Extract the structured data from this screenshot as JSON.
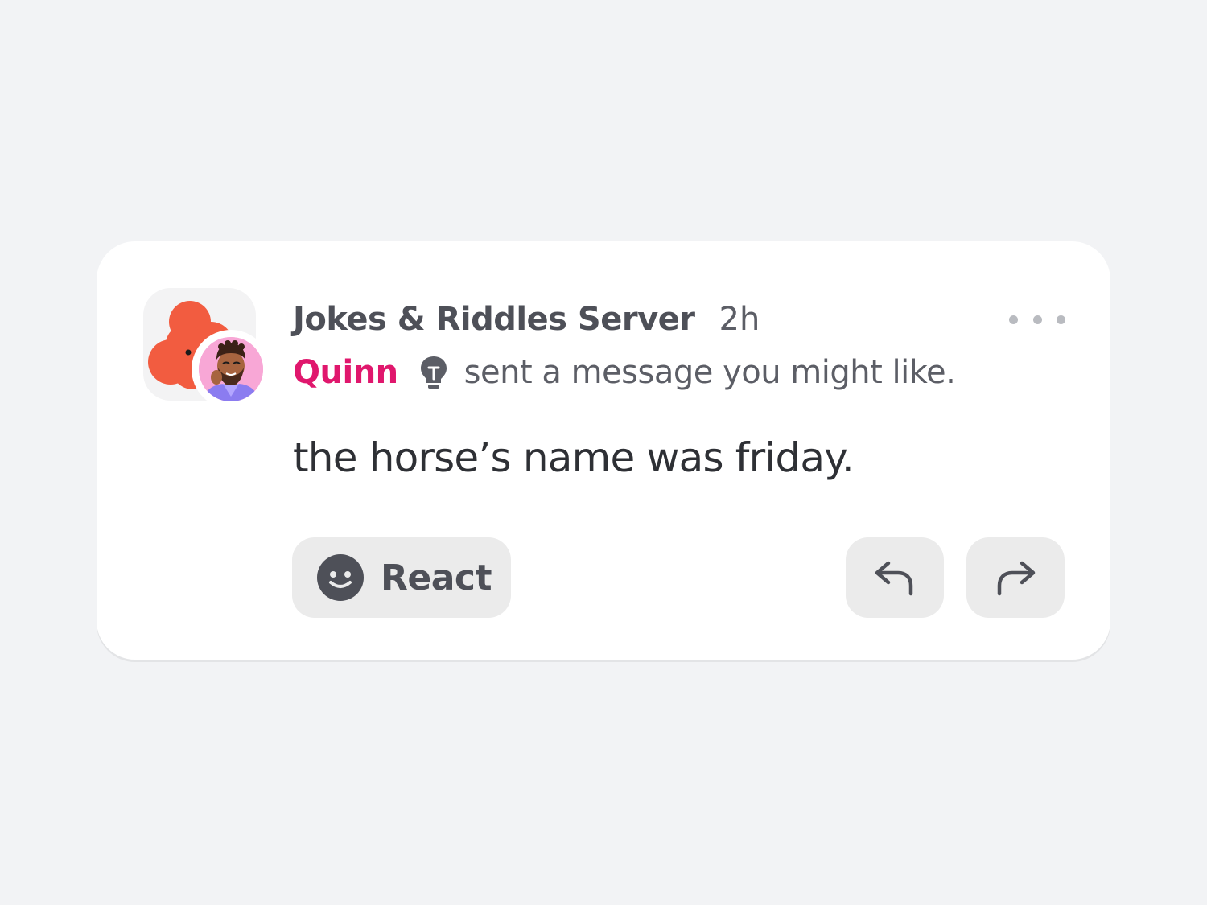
{
  "notification": {
    "server_name": "Jokes & Riddles Server",
    "timestamp": "2h",
    "sender_name": "Quinn",
    "action_text": "sent a message you might like.",
    "message": "the horse’s name was friday.",
    "react_label": "React"
  },
  "icons": {
    "server": "server-flower-icon",
    "avatar": "user-avatar",
    "bulb": "lightbulb-icon",
    "more": "more-dots-icon",
    "react": "smiley-icon",
    "reply": "reply-arrow-icon",
    "forward": "forward-arrow-icon"
  },
  "colors": {
    "background": "#f2f3f5",
    "card": "#ffffff",
    "sender": "#e0176d",
    "server_icon": "#f25c40",
    "button": "#ebebeb",
    "text_primary": "#2e3035",
    "text_secondary": "#5c5e66"
  }
}
